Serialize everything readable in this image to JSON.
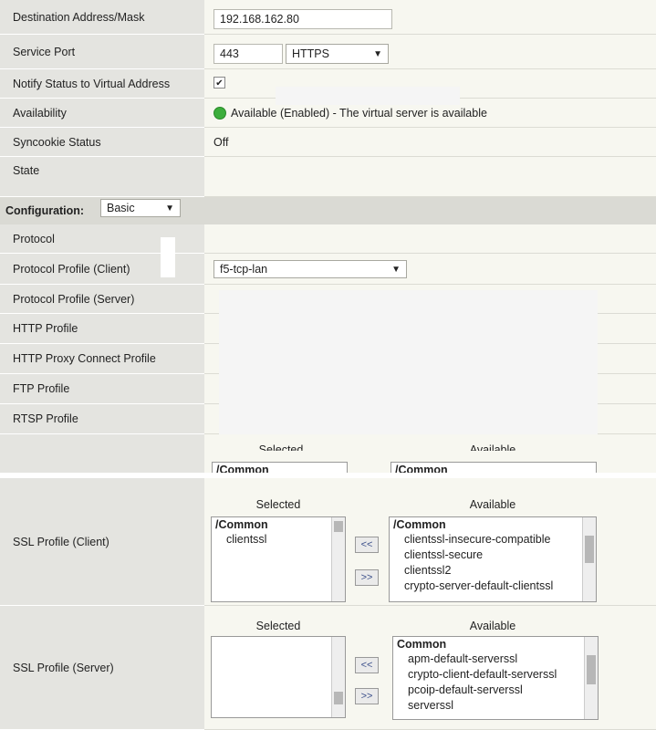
{
  "general": {
    "destination_label": "Destination Address/Mask",
    "destination_value": "192.168.162.80",
    "service_port_label": "Service Port",
    "service_port_value": "443",
    "service_port_protocol": "HTTPS",
    "notify_label": "Notify Status to Virtual Address",
    "notify_checked": "✔",
    "availability_label": "Availability",
    "availability_value": "Available (Enabled) - The virtual server is available",
    "syncookie_label": "Syncookie Status",
    "syncookie_value": "Off",
    "state_label": "State"
  },
  "configuration": {
    "label": "Configuration:",
    "mode": "Basic"
  },
  "profiles": {
    "protocol_label": "Protocol",
    "protocol_client_label": "Protocol Profile (Client)",
    "protocol_client_value": "f5-tcp-lan",
    "protocol_server_label": "Protocol Profile (Server)",
    "http_label": "HTTP Profile",
    "http_proxy_label": "HTTP Proxy Connect Profile",
    "ftp_label": "FTP Profile",
    "rtsp_label": "RTSP Profile"
  },
  "partial_header": {
    "selected": "Selected",
    "available": "Available",
    "left_group": "/Common",
    "right_group": "/Common"
  },
  "ssl_client": {
    "label": "SSL Profile (Client)",
    "selected_header": "Selected",
    "available_header": "Available",
    "selected_group": "/Common",
    "selected_items": [
      "clientssl"
    ],
    "available_group": "/Common",
    "available_items": [
      "clientssl-insecure-compatible",
      "clientssl-secure",
      "clientssl2",
      "crypto-server-default-clientssl"
    ],
    "move_left": "<<",
    "move_right": ">>"
  },
  "ssl_server": {
    "label": "SSL Profile (Server)",
    "selected_header": "Selected",
    "available_header": "Available",
    "available_group": "Common",
    "available_items": [
      "apm-default-serverssl",
      "crypto-client-default-serverssl",
      "pcoip-default-serverssl",
      "serverssl"
    ],
    "move_left": "<<",
    "move_right": ">>"
  }
}
